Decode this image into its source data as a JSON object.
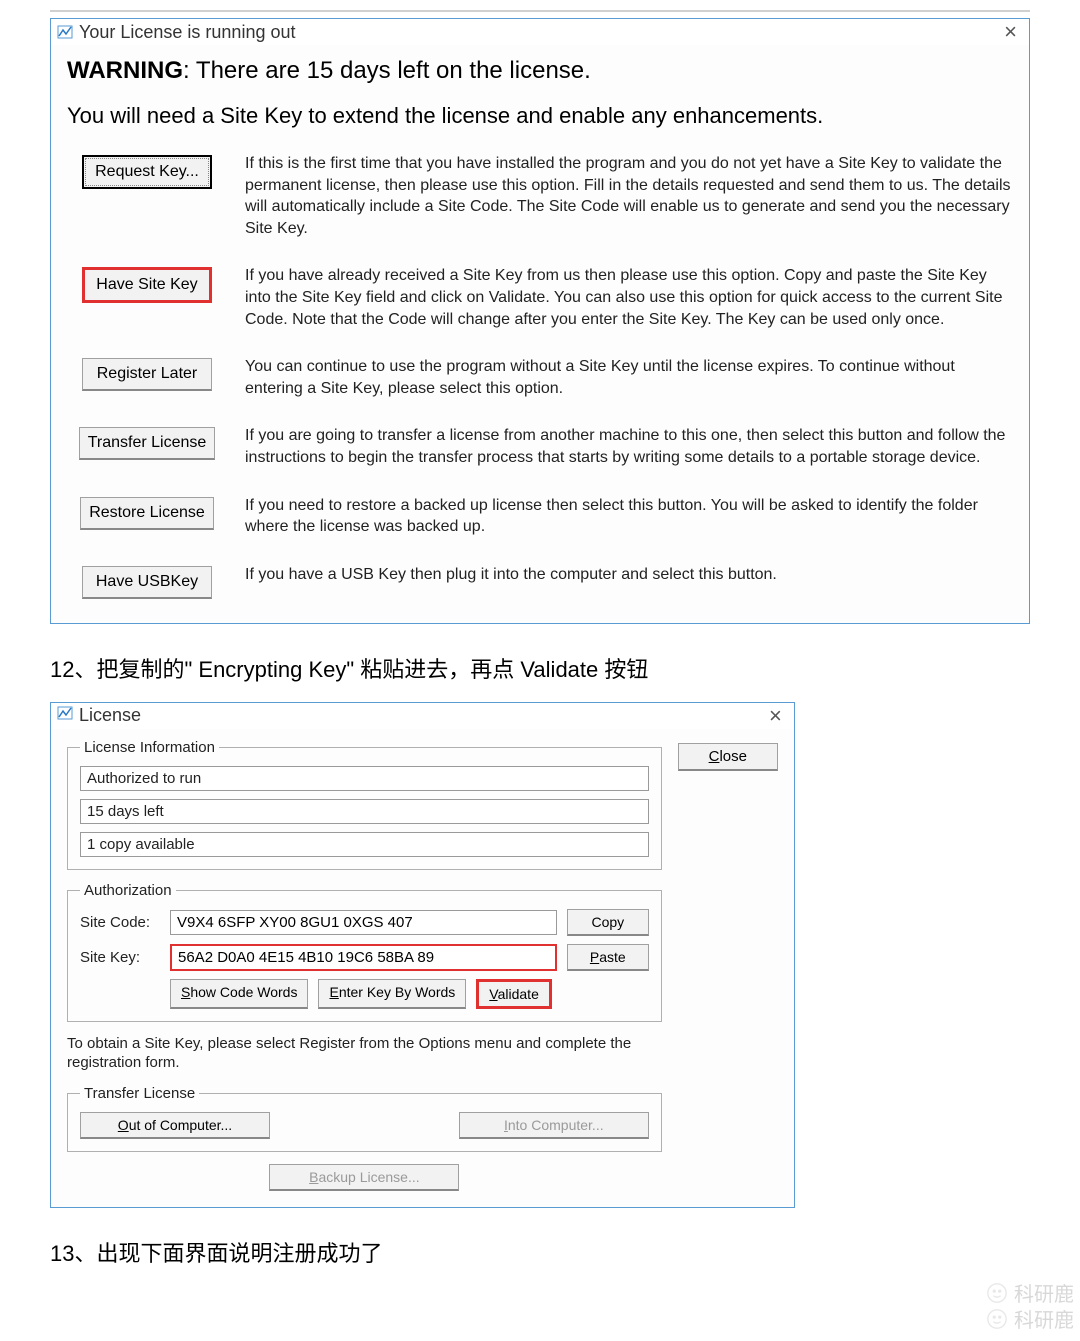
{
  "dialog1": {
    "title": "Your License is running out",
    "warning_prefix": "WARNING",
    "warning_rest": ": There are 15 days left on the license.",
    "subhead": "You will need a Site Key to extend the license and enable any enhancements.",
    "options": [
      {
        "button": "Request Key...",
        "desc": "If this is the first time that you have installed the program and you do not yet have a Site Key to validate the permanent license, then please use this option. Fill in the details requested and send them to us. The details will automatically include a Site Code. The Site Code will enable us to generate and send you the necessary Site Key."
      },
      {
        "button": "Have Site Key",
        "desc": "If you have already received a Site Key from us then please use this option. Copy and paste the Site Key into the Site Key field and click on Validate. You can also use this option for quick access to the current Site Code. Note that the Code will change after you enter the Site Key. The Key can be used only once."
      },
      {
        "button": "Register Later",
        "desc": "You can continue to use the program without a Site Key until the license expires. To continue without entering a Site Key, please select this option."
      },
      {
        "button": "Transfer License",
        "desc": "If you are going to transfer a license from another machine to this one, then select this button and follow the instructions to begin the transfer process that starts by writing some details to a portable storage device."
      },
      {
        "button": "Restore License",
        "desc": "If you need to restore a backed up license then select this button. You will be asked to identify the folder where the license was backed up."
      },
      {
        "button": "Have USBKey",
        "desc": "If you have a USB Key then plug it into the computer and select this button."
      }
    ]
  },
  "step12": "12、把复制的\"  Encrypting Key\"  粘贴进去，再点 Validate 按钮",
  "dialog2": {
    "title": "License",
    "close_btn": "Close",
    "license_info_legend": "License Information",
    "authorized": "Authorized to run",
    "days_left": "15 days left",
    "copies": "1 copy available",
    "auth_legend": "Authorization",
    "site_code_label": "Site Code:",
    "site_code_value": "V9X4 6SFP XY00 8GU1 0XGS 407",
    "copy_btn": "Copy",
    "site_key_label": "Site Key:",
    "site_key_value": "56A2 D0A0 4E15 4B10 19C6 58BA 89",
    "paste_btn": "Paste",
    "show_words": "Show Code Words",
    "enter_words": "Enter Key By Words",
    "validate": "Validate",
    "info_text": "To obtain a Site Key, please select Register from the Options menu and complete the registration form.",
    "transfer_legend": "Transfer License",
    "out_btn": "Out of Computer...",
    "into_btn": "Into Computer...",
    "backup_btn": "Backup License..."
  },
  "step13": "13、出现下面界面说明注册成功了",
  "watermark": "科研鹿"
}
